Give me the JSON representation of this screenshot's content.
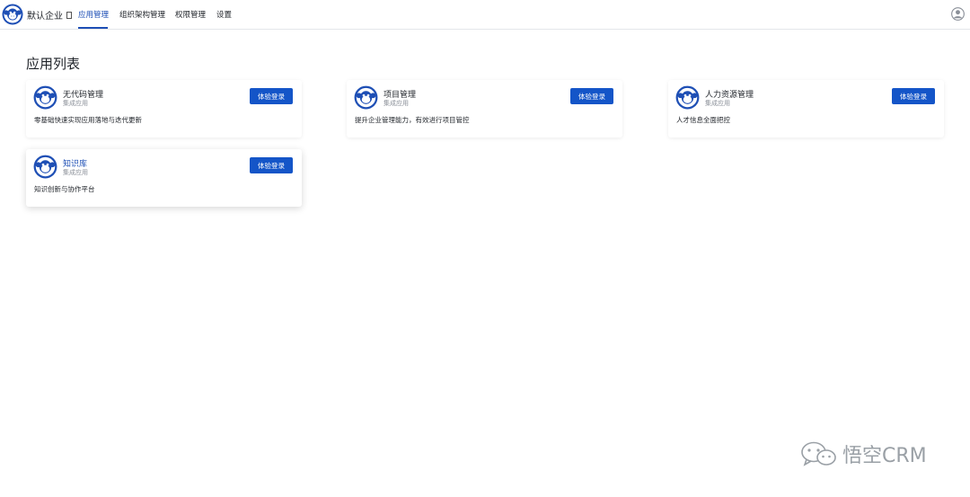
{
  "header": {
    "company": "默认企业",
    "nav": [
      {
        "label": "应用管理",
        "active": true
      },
      {
        "label": "组织架构管理",
        "active": false
      },
      {
        "label": "权限管理",
        "active": false
      },
      {
        "label": "设置",
        "active": false
      }
    ],
    "icons": {
      "logo": "monkey-logo-icon",
      "user": "user-avatar-icon"
    }
  },
  "main": {
    "title": "应用列表",
    "apps": [
      {
        "name": "无代码管理",
        "type": "集成应用",
        "description": "零基础快速实现应用落地与迭代更新",
        "button": "体验登录"
      },
      {
        "name": "项目管理",
        "type": "集成应用",
        "description": "提升企业管理能力，有效进行项目管控",
        "button": "体验登录"
      },
      {
        "name": "人力资源管理",
        "type": "集成应用",
        "description": "人才信息全面把控",
        "button": "体验登录"
      },
      {
        "name": "知识库",
        "type": "集成应用",
        "description": "知识创新与协作平台",
        "button": "体验登录"
      }
    ]
  },
  "watermark": {
    "text": "悟空CRM",
    "icon": "wechat-icon"
  },
  "colors": {
    "accent": "#1e4fb5",
    "button": "#1455c8",
    "border": "#e4e6ea"
  }
}
